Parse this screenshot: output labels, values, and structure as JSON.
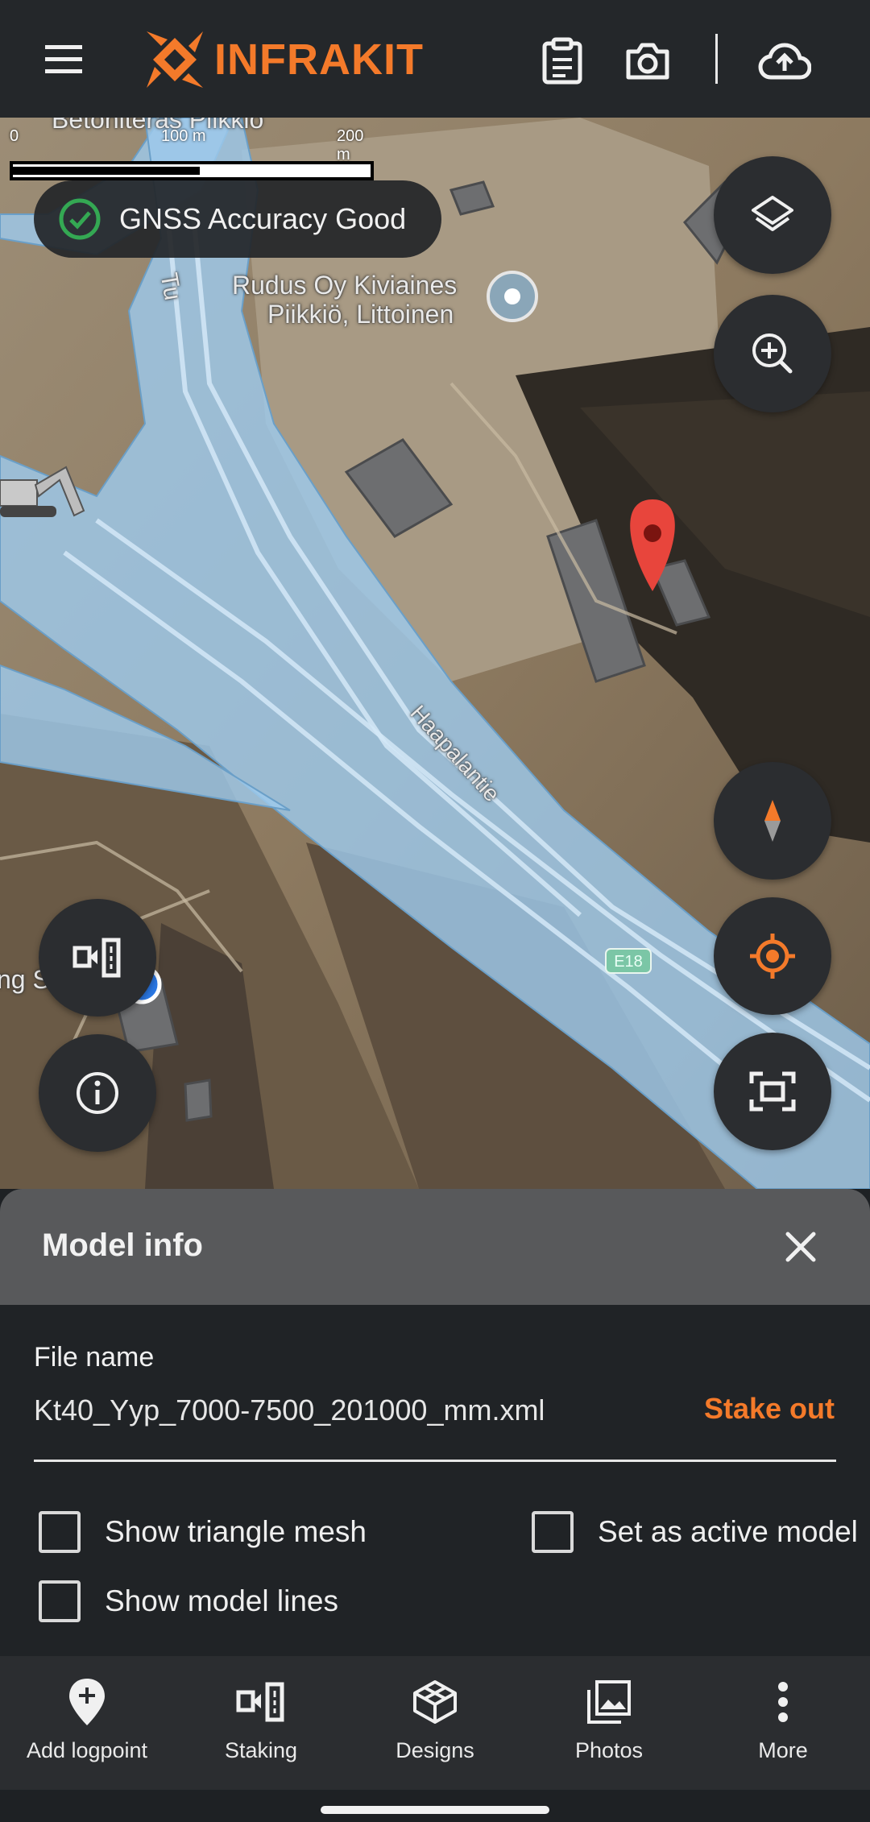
{
  "app": {
    "brand": "INFRAKIT"
  },
  "map": {
    "scale": {
      "label_0": "0",
      "label_100": "100 m",
      "label_200": "200 m"
    },
    "gnss_status": "GNSS Accuracy Good",
    "places": {
      "top_clip": "Betoniteräs Piikkiö",
      "rudus_line1": "Rudus Oy Kiviaines",
      "rudus_line2": "Piikkiö, Littoinen",
      "road_turku": "Tu",
      "road_haapalantie": "Haapalantie",
      "road_e18": "E18",
      "left_clip": "ng S"
    }
  },
  "sheet": {
    "title": "Model info",
    "file_label": "File name",
    "file_value": "Kt40_Yyp_7000-7500_201000_mm.xml",
    "stake_out": "Stake out",
    "checkboxes": {
      "triangle_mesh": "Show triangle mesh",
      "active_model": "Set as active model",
      "model_lines": "Show model lines"
    }
  },
  "nav": {
    "items": [
      {
        "label": "Add logpoint",
        "icon": "add-logpoint-icon"
      },
      {
        "label": "Staking",
        "icon": "staking-icon"
      },
      {
        "label": "Designs",
        "icon": "designs-icon"
      },
      {
        "label": "Photos",
        "icon": "photos-icon"
      },
      {
        "label": "More",
        "icon": "more-vert-icon"
      }
    ]
  },
  "colors": {
    "accent": "#f47a2a",
    "bar": "#24272a",
    "sheet_header": "#58595b",
    "road_overlay": "#9ec9ec",
    "marker": "#e8453c",
    "gnss_check": "#34a853"
  }
}
